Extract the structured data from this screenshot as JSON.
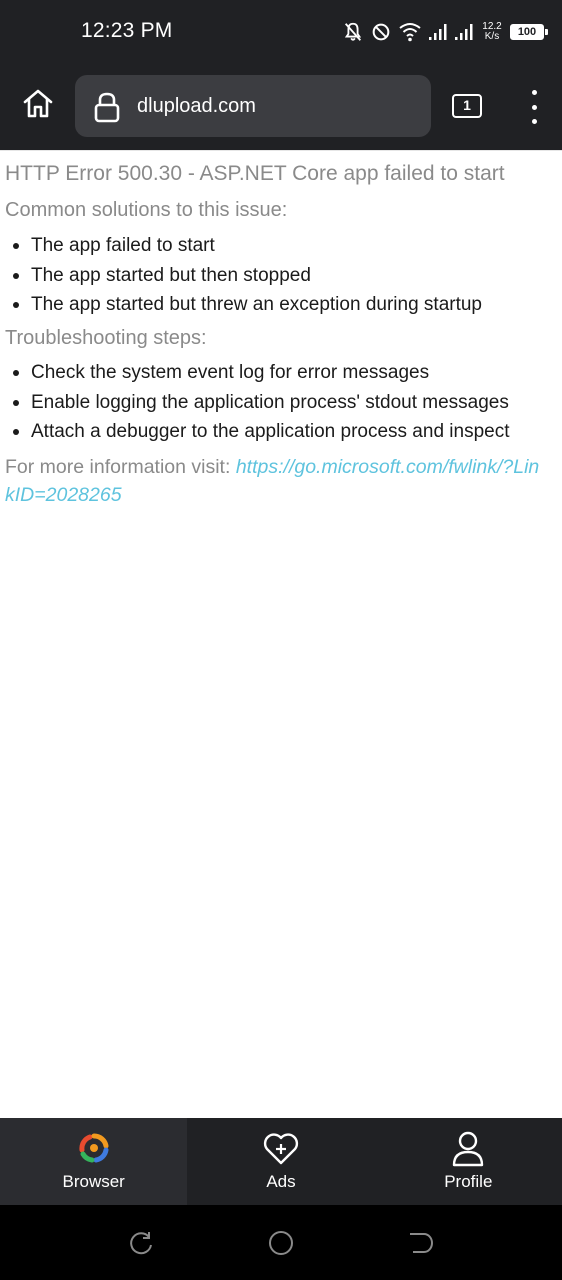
{
  "status_bar": {
    "time": "12:23 PM",
    "net_speed_value": "12.2",
    "net_speed_unit": "K/s",
    "battery": "100",
    "icons": [
      "bell-off-icon",
      "do-not-disturb-icon",
      "wifi-icon",
      "signal-icon",
      "signal-icon"
    ]
  },
  "toolbar": {
    "url": "dlupload.com",
    "tab_count": "1",
    "icons": [
      "home-icon",
      "lock-icon",
      "more-vert-icon"
    ]
  },
  "page": {
    "title": "HTTP Error 500.30 - ASP.NET Core app failed to start",
    "solutions_heading": "Common solutions to this issue:",
    "solutions": [
      "The app failed to start",
      "The app started but then stopped",
      "The app started but threw an exception during startup"
    ],
    "troubleshooting_heading": "Troubleshooting steps:",
    "steps": [
      "Check the system event log for error messages",
      "Enable logging the application process' stdout messages",
      "Attach a debugger to the application process and inspect"
    ],
    "more_info_prefix": "For more information visit:",
    "more_info_link": "https://go.microsoft.com/fwlink/?LinkID=2028265"
  },
  "bottom_nav": {
    "items": [
      {
        "label": "Browser",
        "icon": "browser-logo-icon",
        "active": true
      },
      {
        "label": "Ads",
        "icon": "heart-plus-icon",
        "active": false
      },
      {
        "label": "Profile",
        "icon": "person-icon",
        "active": false
      }
    ]
  },
  "system_nav": {
    "icons": [
      "recents-icon",
      "home-circle-icon",
      "back-icon"
    ]
  },
  "colors": {
    "chrome": "#202124",
    "url_bar": "#3c3d41",
    "link": "#5ec3de",
    "muted_text": "#8a8a8a"
  }
}
